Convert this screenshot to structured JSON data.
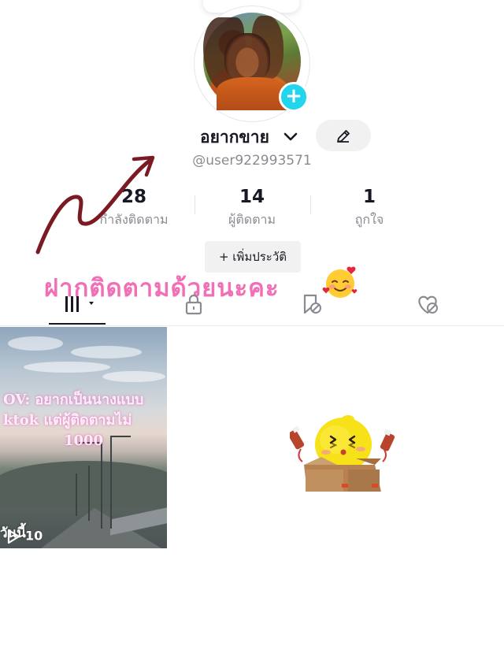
{
  "profile": {
    "name": "อยากขาย",
    "handle": "@user922993571",
    "bio_button": "+ เพิ่มประวัติ"
  },
  "stats": [
    {
      "value": "28",
      "label": "กำลังติดตาม"
    },
    {
      "value": "14",
      "label": "ผู้ติดตาม"
    },
    {
      "value": "1",
      "label": "ถูกใจ"
    }
  ],
  "overlay": {
    "caption": "ฝากติดตามด้วยนะคะ",
    "emoji": "smiling-face-with-hearts"
  },
  "tabs": [
    {
      "icon": "grid-icon",
      "active": true
    },
    {
      "icon": "lock-icon",
      "active": false
    },
    {
      "icon": "bookmark-hidden-icon",
      "active": false
    },
    {
      "icon": "heart-hidden-icon",
      "active": false
    }
  ],
  "videos": [
    {
      "overlay_lines": [
        "OV: อยากเป็นนางแบบ",
        "ktok แต่ผู้ติดตามไม่",
        "1000"
      ],
      "bottom_text": "วันนี้",
      "views": "10"
    }
  ],
  "colors": {
    "accent": "#20d5ec",
    "caption_pink": "#f06fb6",
    "text_primary": "#161823",
    "text_secondary": "#8a8b91"
  }
}
